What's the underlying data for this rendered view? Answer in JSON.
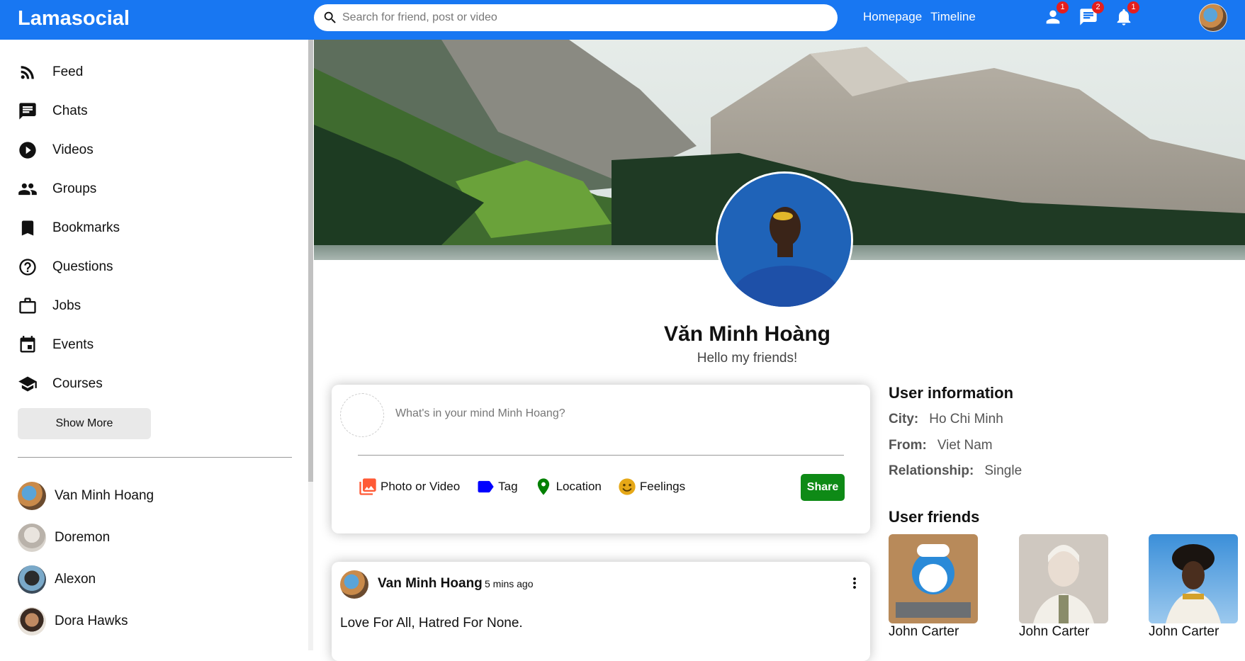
{
  "app": {
    "logo": "Lamasocial"
  },
  "search": {
    "placeholder": "Search for friend, post or video"
  },
  "nav": {
    "links": [
      "Homepage",
      "Timeline"
    ]
  },
  "notifications": {
    "friends": "1",
    "chats": "2",
    "alerts": "1"
  },
  "sidebar": {
    "items": [
      {
        "label": "Feed",
        "icon": "rss-feed-icon"
      },
      {
        "label": "Chats",
        "icon": "chat-icon"
      },
      {
        "label": "Videos",
        "icon": "play-circle-icon"
      },
      {
        "label": "Groups",
        "icon": "group-icon"
      },
      {
        "label": "Bookmarks",
        "icon": "bookmark-icon"
      },
      {
        "label": "Questions",
        "icon": "help-outline-icon"
      },
      {
        "label": "Jobs",
        "icon": "work-outline-icon"
      },
      {
        "label": "Events",
        "icon": "event-icon"
      },
      {
        "label": "Courses",
        "icon": "school-icon"
      }
    ],
    "show_more": "Show More",
    "friends": [
      "Van Minh Hoang",
      "Doremon",
      "Alexon",
      "Dora Hawks"
    ]
  },
  "profile": {
    "name": "Văn Minh Hoàng",
    "desc": "Hello my friends!"
  },
  "share": {
    "placeholder": "What's in your mind Minh Hoang?",
    "options": [
      "Photo or Video",
      "Tag",
      "Location",
      "Feelings"
    ],
    "button": "Share",
    "colors": {
      "photo": "#ff5a36",
      "tag": "#0000ff",
      "location": "#008000",
      "feelings": "#e6a817",
      "share_button": "#0e8a16"
    }
  },
  "post": {
    "user": "Van Minh Hoang",
    "date": "5 mins ago",
    "text": "Love For All, Hatred For None."
  },
  "user_info": {
    "title": "User information",
    "city_label": "City:",
    "city": "Ho Chi Minh",
    "from_label": "From:",
    "from": "Viet Nam",
    "relationship_label": "Relationship:",
    "relationship": "Single"
  },
  "user_friends": {
    "title": "User friends",
    "items": [
      "John Carter",
      "John Carter",
      "John Carter"
    ]
  },
  "colors": {
    "brand": "#1877f2",
    "badge": "#e41e1e"
  }
}
